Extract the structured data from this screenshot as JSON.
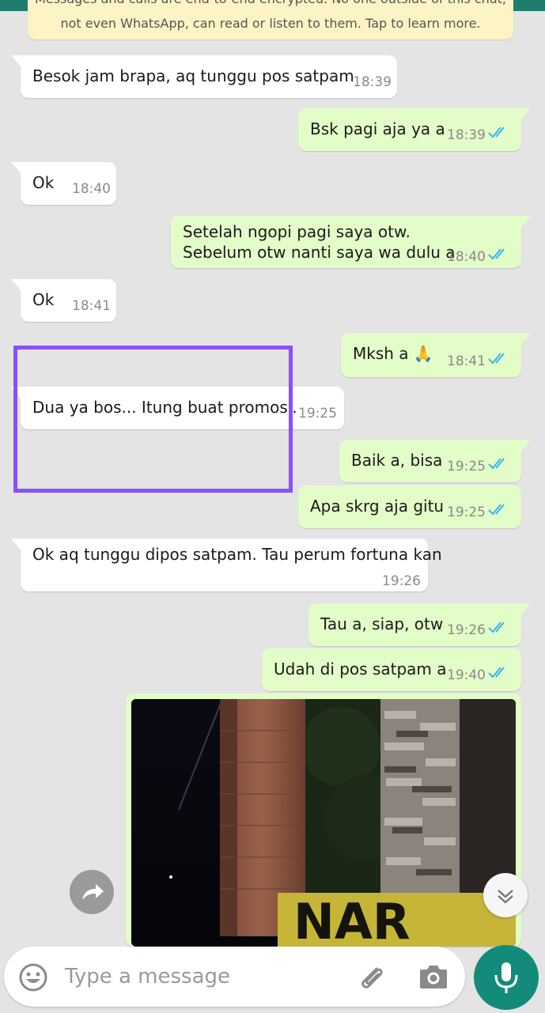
{
  "banner": {
    "line1": "Messages and calls are end-to-end encrypted. No one outside of this chat,",
    "line2": "not even WhatsApp, can read or listen to them. Tap to learn more."
  },
  "messages": [
    {
      "dir": "in",
      "text": "Besok jam brapa, aq tunggu pos satpam",
      "time": "18:39"
    },
    {
      "dir": "out",
      "text": "Bsk pagi aja ya a",
      "time": "18:39",
      "status": "read"
    },
    {
      "dir": "in",
      "text": "Ok",
      "time": "18:40"
    },
    {
      "dir": "out",
      "line1": "Setelah ngopi pagi saya otw.",
      "line2": "Sebelum otw nanti saya wa dulu a",
      "time": "18:40",
      "status": "read"
    },
    {
      "dir": "in",
      "text": "Ok",
      "time": "18:41"
    },
    {
      "dir": "out",
      "text": "Mksh a 🙏",
      "time": "18:41",
      "status": "read"
    },
    {
      "dir": "in",
      "text": "Dua ya bos... Itung buat promosi.",
      "time": "19:25"
    },
    {
      "dir": "out",
      "text": "Baik a, bisa",
      "time": "19:25",
      "status": "read"
    },
    {
      "dir": "out",
      "text": "Apa skrg aja gitu",
      "time": "19:25",
      "status": "read"
    },
    {
      "dir": "in",
      "text": "Ok aq tunggu dipos satpam. Tau perum fortuna kan",
      "time": "19:26"
    },
    {
      "dir": "out",
      "text": "Tau a, siap, otw",
      "time": "19:26",
      "status": "read"
    },
    {
      "dir": "out",
      "text": "Udah di pos satpam a",
      "time": "19:40",
      "status": "read"
    },
    {
      "dir": "out",
      "type": "image",
      "banner_text": "NAR"
    }
  ],
  "composer": {
    "placeholder": "Type a message",
    "icons": [
      "emoji-icon",
      "attachment-icon",
      "camera-icon",
      "mic-icon"
    ]
  },
  "colors": {
    "incoming": "#ffffff",
    "outgoing": "#e3fdc8",
    "read_check": "#34b7f1",
    "highlight_box": "#8a4fff",
    "accent": "#138b7b"
  }
}
